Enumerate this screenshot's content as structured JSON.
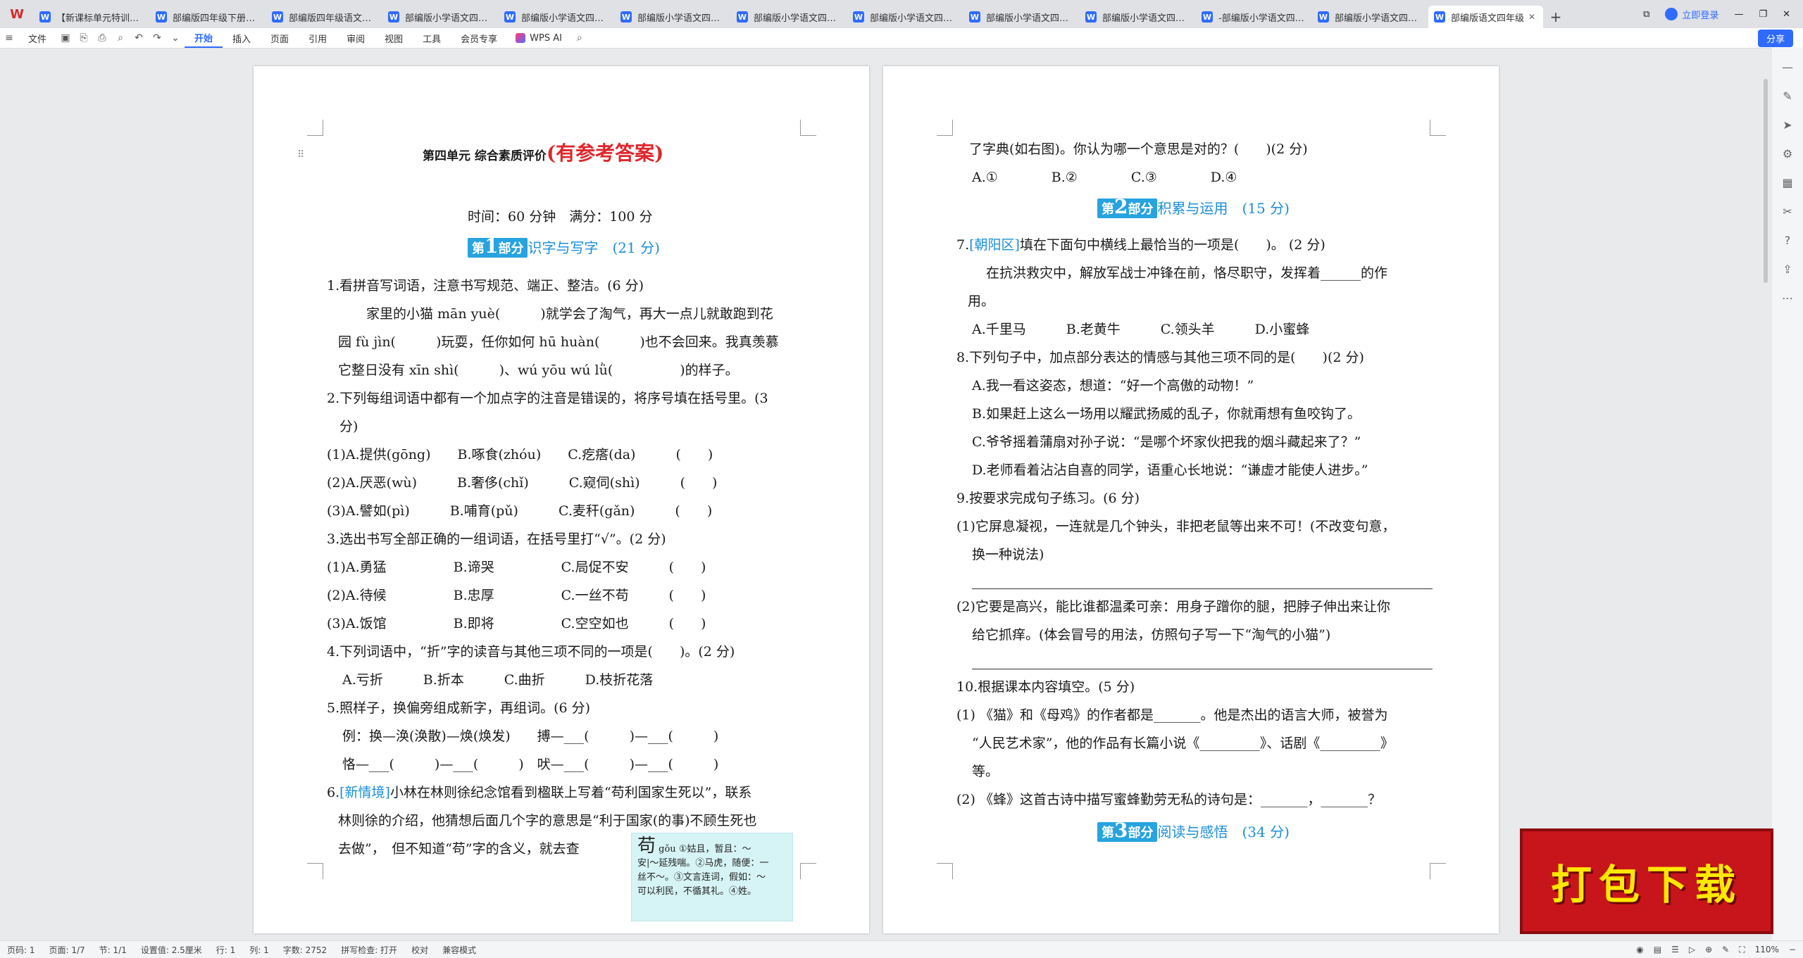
{
  "tabs": [
    {
      "label": "【新课标单元特训】部"
    },
    {
      "label": "部编版四年级下册语文"
    },
    {
      "label": "部编版四年级语文下册"
    },
    {
      "label": "部编版小学语文四年级"
    },
    {
      "label": "部编版小学语文四年级"
    },
    {
      "label": "部编版小学语文四年级"
    },
    {
      "label": "部编版小学语文四年级"
    },
    {
      "label": "部编版小学语文四年级"
    },
    {
      "label": "部编版小学语文四年级"
    },
    {
      "label": "部编版小学语文四年级"
    },
    {
      "label": "-部编版小学语文四年级"
    },
    {
      "label": "部编版小学语文四年级"
    },
    {
      "label": "部编版语文四年级"
    }
  ],
  "topbar": {
    "login": "立即登录"
  },
  "ribbon": {
    "file": "文件",
    "tabs": [
      "开始",
      "插入",
      "页面",
      "引用",
      "审阅",
      "视图",
      "工具",
      "会员专享"
    ],
    "wps_ai": "WPS AI",
    "share": "分享"
  },
  "page1": {
    "title": "第四单元 综合素质评价",
    "title_red": "(有参考答案)",
    "time": "时间：60 分钟　满分：100 分",
    "section1": {
      "pre": "第",
      "num": "1",
      "post": "部分",
      "text": "识字与写字　(21 分)"
    },
    "lines": [
      "1.看拼音写词语，注意书写规范、端正、整洁。(6 分)",
      "家里的小猫 mān yuè(　　　)就学会了淘气，再大一点儿就敢跑到花",
      "园 fù jìn(　　　)玩耍，任你如何 hū huàn(　　　)也不会回来。我真羡慕",
      "它整日没有 xīn shì(　　　)、wú yōu wú lǜ(　　　　　)的样子。",
      "2.下列每组词语中都有一个加点字的注音是错误的，将序号填在括号里。(3",
      "分)",
      "(1)A.提供(gōng)　　B.啄食(zhóu)　　C.疙瘩(da)　　　(　　)",
      "(2)A.厌恶(wù)　　　B.奢侈(chǐ)　　　C.窥伺(shì)　　　(　　)",
      "(3)A.譬如(pì)　　　B.哺育(pǔ)　　　C.麦秆(gǎn)　　　(　　)",
      "3.选出书写全部正确的一组词语，在括号里打“√”。(2 分)",
      "(1)A.勇猛　　　　　B.谛哭　　　　　C.局促不安　　　(　　)",
      "(2)A.待候　　　　　B.忠厚　　　　　C.一丝不苟　　　(　　)",
      "(3)A.饭馆　　　　　B.即将　　　　　C.空空如也　　　(　　)",
      "4.下列词语中，“折”字的读音与其他三项不同的一项是(　　)。(2 分)",
      "A.亏折　　　B.折本　　　C.曲折　　　D.枝折花落",
      "5.照样子，换偏旁组成新字，再组词。(6 分)",
      "例：换—涣(涣散)—焕(焕发)　　搏—___(　　　)—___(　　　)",
      "恪—___(　　　)—___(　　　)　吠—___(　　　)—___(　　　)"
    ],
    "q6_tag": "[新情境]",
    "q6_lines": [
      "6.",
      "小林在林则徐纪念馆看到楹联上写着“苟利国家生死以”，联系",
      "林则徐的介绍，他猜想后面几个字的意思是“利于国家(的事)不顾生死也",
      "去做”，　但不知道“苟”字的含义，就去查"
    ],
    "dict": {
      "char": "苟",
      "pinyin": "gǒu",
      "l1": "①姑且，暂且：～",
      "l2": "安|～延残喘。②马虎，随便：一",
      "l3": "丝不～。③文言连词，假如：～",
      "l4": "可以利民，不循其礼。④姓。"
    }
  },
  "page2": {
    "lines_top": [
      "了字典(如右图)。你认为哪一个意思是对的？(　　)(2 分)",
      "A.①　　　　B.②　　　　C.③　　　　D.④"
    ],
    "section2": {
      "pre": "第",
      "num": "2",
      "post": "部分",
      "text": "积累与运用　(15 分)"
    },
    "q7_tag": "[朝阳区]",
    "q7": "填在下面句中横线上最恰当的一项是(　　)。 (2 分)",
    "q7_lines": [
      "在抗洪救灾中，解放军战士冲锋在前，恪尽职守，发挥着______的作",
      "用。",
      "A.千里马　　　B.老黄牛　　　C.领头羊　　　D.小蜜蜂",
      "8.下列句子中，加点部分表达的情感与其他三项不同的是(　　)(2 分)",
      "A.我一看这姿态，想道：“好一个高傲的动物！”",
      "B.如果赶上这么一场用以耀武扬威的乱子，你就甭想有鱼咬钩了。",
      "C.爷爷摇着蒲扇对孙子说：“是哪个坏家伙把我的烟斗藏起来了？”",
      "D.老师看着沾沾自喜的同学，语重心长地说：“谦虚才能使人进步。”",
      "9.按要求完成句子练习。(6 分)",
      "(1)它屏息凝视，一连就是几个钟头，非把老鼠等出来不可！(不改变句意，",
      "换一种说法)",
      "(2)它要是高兴，能比谁都温柔可亲：用身子蹭你的腿，把脖子伸出来让你",
      "给它抓痒。(体会冒号的用法，仿照句子写一下“淘气的小猫”)",
      "10.根据课本内容填空。(5 分)",
      "(1) 《猫》和《母鸡》的作者都是_______。他是杰出的语言大师，被誉为",
      "“人民艺术家”，他的作品有长篇小说《_________》、话剧《_________》",
      "等。",
      "(2) 《蜂》这首古诗中描写蜜蜂勤劳无私的诗句是：_______，_______？"
    ],
    "section3": {
      "pre": "第",
      "num": "3",
      "post": "部分",
      "text": "阅读与感悟　(34 分)"
    }
  },
  "status": {
    "page_no": "页码: 1",
    "pages": "页面: 1/7",
    "section": "节: 1/1",
    "setting": "设置值: 2.5厘米",
    "row": "行: 1",
    "col": "列: 1",
    "words": "字数: 2752",
    "spell": "拼写检查: 打开",
    "proof": "校对",
    "compat": "兼容模式",
    "zoom": "110%"
  },
  "banner": {
    "text": "打包下载"
  },
  "colors": {
    "accent": "#2f6bff",
    "title_red": "#e0262c",
    "section_blue": "#27a3e0",
    "banner_red": "#c8151b",
    "banner_yellow": "#ffe800"
  }
}
